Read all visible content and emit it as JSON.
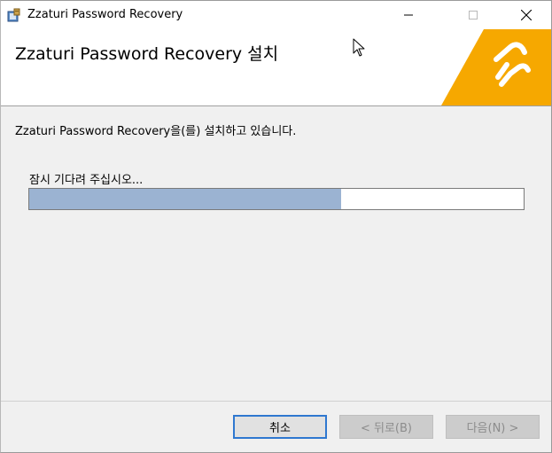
{
  "window": {
    "title": "Zzaturi Password Recovery"
  },
  "banner": {
    "title": "Zzaturi Password Recovery 설치",
    "logo_color": "#f6a800"
  },
  "content": {
    "status": "Zzaturi Password Recovery을(를) 설치하고 있습니다.",
    "wait": "잠시 기다려 주십시오...",
    "progress_fraction": 0.63,
    "progress_color": "#9bb3d2"
  },
  "buttons": {
    "cancel": "취소",
    "back": "< 뒤로(B)",
    "next": "다음(N) >"
  },
  "icons": {
    "app": "installer-icon",
    "minimize": "minimize-icon",
    "maximize": "maximize-icon",
    "close": "close-icon",
    "cursor": "mouse-cursor-icon"
  }
}
